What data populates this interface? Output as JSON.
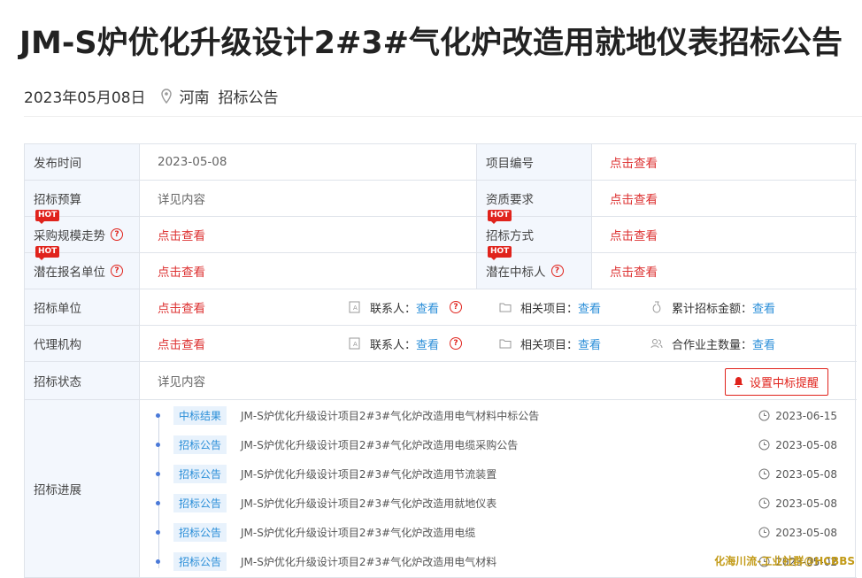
{
  "title": "JM-S炉优化升级设计2#3#气化炉改造用就地仪表招标公告",
  "meta": {
    "date": "2023年05月08日",
    "region": "河南",
    "category": "招标公告"
  },
  "rows": {
    "publish_time": {
      "label": "发布时间",
      "value": "2023-05-08"
    },
    "project_no": {
      "label": "项目编号",
      "value": "点击查看"
    },
    "budget": {
      "label": "招标预算",
      "value": "详见内容"
    },
    "qualification": {
      "label": "资质要求",
      "value": "点击查看"
    },
    "scale_trend": {
      "label": "采购规模走势",
      "value": "点击查看",
      "hot": "HOT"
    },
    "bid_method": {
      "label": "招标方式",
      "value": "点击查看",
      "hot": "HOT"
    },
    "potential_signup": {
      "label": "潜在报名单位",
      "value": "点击查看",
      "hot": "HOT"
    },
    "potential_winner": {
      "label": "潜在中标人",
      "value": "点击查看",
      "hot": "HOT"
    },
    "tender_unit": {
      "label": "招标单位",
      "value": "点击查看",
      "contact_label": "联系人：",
      "contact_value": "查看",
      "related_label": "相关项目：",
      "related_value": "查看",
      "total_label": "累计招标金额：",
      "total_value": "查看"
    },
    "agency": {
      "label": "代理机构",
      "value": "点击查看",
      "contact_label": "联系人：",
      "contact_value": "查看",
      "related_label": "相关项目：",
      "related_value": "查看",
      "partner_label": "合作业主数量：",
      "partner_value": "查看"
    },
    "status": {
      "label": "招标状态",
      "value": "详见内容",
      "remind_button": "设置中标提醒"
    },
    "progress": {
      "label": "招标进展"
    }
  },
  "progress_items": [
    {
      "tag": "中标结果",
      "text": "JM-S炉优化升级设计项目2#3#气化炉改造用电气材料中标公告",
      "date": "2023-06-15"
    },
    {
      "tag": "招标公告",
      "text": "JM-S炉优化升级设计项目2#3#气化炉改造用电缆采购公告",
      "date": "2023-05-08"
    },
    {
      "tag": "招标公告",
      "text": "JM-S炉优化升级设计项目2#3#气化炉改造用节流装置",
      "date": "2023-05-08"
    },
    {
      "tag": "招标公告",
      "text": "JM-S炉优化升级设计项目2#3#气化炉改造用就地仪表",
      "date": "2023-05-08"
    },
    {
      "tag": "招标公告",
      "text": "JM-S炉优化升级设计项目2#3#气化炉改造用电缆",
      "date": "2023-05-08"
    },
    {
      "tag": "招标公告",
      "text": "JM-S炉优化升级设计项目2#3#气化炉改造用电气材料",
      "date": "2023-05-02"
    }
  ],
  "watermark": "化海川流-工业社群@HCBBS"
}
